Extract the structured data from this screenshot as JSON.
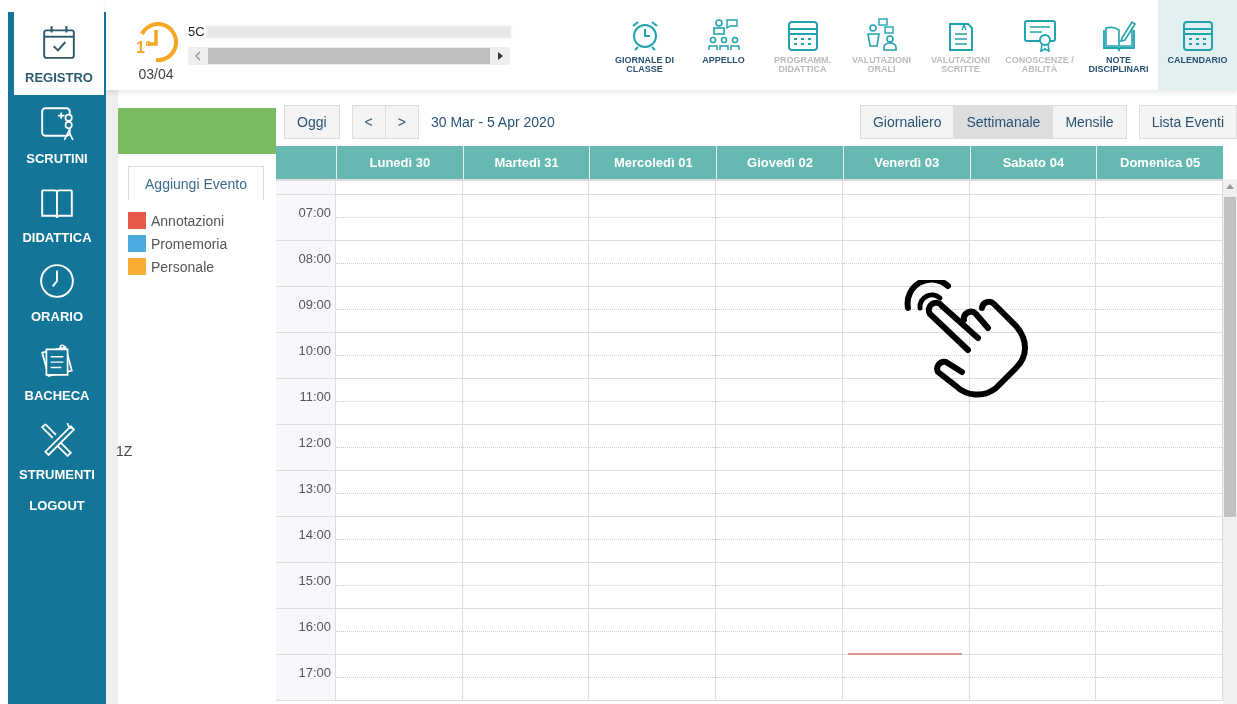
{
  "sidebar": {
    "items": [
      {
        "label": "REGISTRO",
        "selected": true
      },
      {
        "label": "SCRUTINI",
        "selected": false
      },
      {
        "label": "DIDATTICA",
        "selected": false
      },
      {
        "label": "ORARIO",
        "selected": false
      },
      {
        "label": "BACHECA",
        "selected": false
      },
      {
        "label": "STRUMENTI",
        "selected": false
      },
      {
        "label": "LOGOUT",
        "selected": false
      }
    ]
  },
  "header": {
    "hour_badge": "1°",
    "date": "03/04",
    "class_name": "5C",
    "toolbar": [
      {
        "label": "GIORNALE DI\nCLASSE",
        "disabled": false,
        "selected": false
      },
      {
        "label": "APPELLO",
        "disabled": false,
        "selected": false
      },
      {
        "label": "PROGRAMM.\nDIDATTICA",
        "disabled": true,
        "selected": false
      },
      {
        "label": "VALUTAZIONI\nORALI",
        "disabled": true,
        "selected": false
      },
      {
        "label": "VALUTAZIONI\nSCRITTE",
        "disabled": true,
        "selected": false
      },
      {
        "label": "CONOSCENZE /\nABILITÀ",
        "disabled": true,
        "selected": false
      },
      {
        "label": "NOTE\nDISCIPLINARI",
        "disabled": false,
        "selected": false
      },
      {
        "label": "CALENDARIO",
        "disabled": false,
        "selected": true
      }
    ]
  },
  "left_panel": {
    "tab": "Aggiungi Evento",
    "legend": [
      {
        "label": "Annotazioni",
        "color": "#e8594a"
      },
      {
        "label": "Promemoria",
        "color": "#4ea9df"
      },
      {
        "label": "Personale",
        "color": "#f7ae32"
      }
    ],
    "note": "1Z"
  },
  "calendar": {
    "today_button": "Oggi",
    "prev_button": "<",
    "next_button": ">",
    "range": "30 Mar - 5 Apr 2020",
    "views": [
      {
        "label": "Giornaliero",
        "selected": false
      },
      {
        "label": "Settimanale",
        "selected": true
      },
      {
        "label": "Mensile",
        "selected": false
      }
    ],
    "list_button": "Lista Eventi",
    "days": [
      "Lunedì 30",
      "Martedì 31",
      "Mercoledì 01",
      "Giovedì 02",
      "Venerdì 03",
      "Sabato 04",
      "Domenica 05"
    ],
    "hours": [
      "07:00",
      "08:00",
      "09:00",
      "10:00",
      "11:00",
      "12:00",
      "13:00",
      "14:00",
      "15:00",
      "16:00",
      "17:00"
    ]
  }
}
